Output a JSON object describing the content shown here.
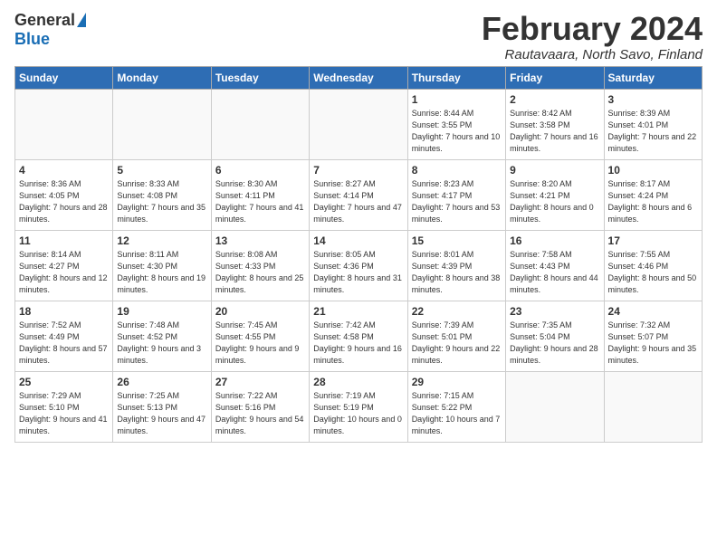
{
  "header": {
    "logo_general": "General",
    "logo_blue": "Blue",
    "title": "February 2024",
    "location": "Rautavaara, North Savo, Finland"
  },
  "calendar": {
    "days_of_week": [
      "Sunday",
      "Monday",
      "Tuesday",
      "Wednesday",
      "Thursday",
      "Friday",
      "Saturday"
    ],
    "weeks": [
      [
        {
          "day": "",
          "info": ""
        },
        {
          "day": "",
          "info": ""
        },
        {
          "day": "",
          "info": ""
        },
        {
          "day": "",
          "info": ""
        },
        {
          "day": "1",
          "info": "Sunrise: 8:44 AM\nSunset: 3:55 PM\nDaylight: 7 hours\nand 10 minutes."
        },
        {
          "day": "2",
          "info": "Sunrise: 8:42 AM\nSunset: 3:58 PM\nDaylight: 7 hours\nand 16 minutes."
        },
        {
          "day": "3",
          "info": "Sunrise: 8:39 AM\nSunset: 4:01 PM\nDaylight: 7 hours\nand 22 minutes."
        }
      ],
      [
        {
          "day": "4",
          "info": "Sunrise: 8:36 AM\nSunset: 4:05 PM\nDaylight: 7 hours\nand 28 minutes."
        },
        {
          "day": "5",
          "info": "Sunrise: 8:33 AM\nSunset: 4:08 PM\nDaylight: 7 hours\nand 35 minutes."
        },
        {
          "day": "6",
          "info": "Sunrise: 8:30 AM\nSunset: 4:11 PM\nDaylight: 7 hours\nand 41 minutes."
        },
        {
          "day": "7",
          "info": "Sunrise: 8:27 AM\nSunset: 4:14 PM\nDaylight: 7 hours\nand 47 minutes."
        },
        {
          "day": "8",
          "info": "Sunrise: 8:23 AM\nSunset: 4:17 PM\nDaylight: 7 hours\nand 53 minutes."
        },
        {
          "day": "9",
          "info": "Sunrise: 8:20 AM\nSunset: 4:21 PM\nDaylight: 8 hours\nand 0 minutes."
        },
        {
          "day": "10",
          "info": "Sunrise: 8:17 AM\nSunset: 4:24 PM\nDaylight: 8 hours\nand 6 minutes."
        }
      ],
      [
        {
          "day": "11",
          "info": "Sunrise: 8:14 AM\nSunset: 4:27 PM\nDaylight: 8 hours\nand 12 minutes."
        },
        {
          "day": "12",
          "info": "Sunrise: 8:11 AM\nSunset: 4:30 PM\nDaylight: 8 hours\nand 19 minutes."
        },
        {
          "day": "13",
          "info": "Sunrise: 8:08 AM\nSunset: 4:33 PM\nDaylight: 8 hours\nand 25 minutes."
        },
        {
          "day": "14",
          "info": "Sunrise: 8:05 AM\nSunset: 4:36 PM\nDaylight: 8 hours\nand 31 minutes."
        },
        {
          "day": "15",
          "info": "Sunrise: 8:01 AM\nSunset: 4:39 PM\nDaylight: 8 hours\nand 38 minutes."
        },
        {
          "day": "16",
          "info": "Sunrise: 7:58 AM\nSunset: 4:43 PM\nDaylight: 8 hours\nand 44 minutes."
        },
        {
          "day": "17",
          "info": "Sunrise: 7:55 AM\nSunset: 4:46 PM\nDaylight: 8 hours\nand 50 minutes."
        }
      ],
      [
        {
          "day": "18",
          "info": "Sunrise: 7:52 AM\nSunset: 4:49 PM\nDaylight: 8 hours\nand 57 minutes."
        },
        {
          "day": "19",
          "info": "Sunrise: 7:48 AM\nSunset: 4:52 PM\nDaylight: 9 hours\nand 3 minutes."
        },
        {
          "day": "20",
          "info": "Sunrise: 7:45 AM\nSunset: 4:55 PM\nDaylight: 9 hours\nand 9 minutes."
        },
        {
          "day": "21",
          "info": "Sunrise: 7:42 AM\nSunset: 4:58 PM\nDaylight: 9 hours\nand 16 minutes."
        },
        {
          "day": "22",
          "info": "Sunrise: 7:39 AM\nSunset: 5:01 PM\nDaylight: 9 hours\nand 22 minutes."
        },
        {
          "day": "23",
          "info": "Sunrise: 7:35 AM\nSunset: 5:04 PM\nDaylight: 9 hours\nand 28 minutes."
        },
        {
          "day": "24",
          "info": "Sunrise: 7:32 AM\nSunset: 5:07 PM\nDaylight: 9 hours\nand 35 minutes."
        }
      ],
      [
        {
          "day": "25",
          "info": "Sunrise: 7:29 AM\nSunset: 5:10 PM\nDaylight: 9 hours\nand 41 minutes."
        },
        {
          "day": "26",
          "info": "Sunrise: 7:25 AM\nSunset: 5:13 PM\nDaylight: 9 hours\nand 47 minutes."
        },
        {
          "day": "27",
          "info": "Sunrise: 7:22 AM\nSunset: 5:16 PM\nDaylight: 9 hours\nand 54 minutes."
        },
        {
          "day": "28",
          "info": "Sunrise: 7:19 AM\nSunset: 5:19 PM\nDaylight: 10 hours\nand 0 minutes."
        },
        {
          "day": "29",
          "info": "Sunrise: 7:15 AM\nSunset: 5:22 PM\nDaylight: 10 hours\nand 7 minutes."
        },
        {
          "day": "",
          "info": ""
        },
        {
          "day": "",
          "info": ""
        }
      ]
    ]
  }
}
